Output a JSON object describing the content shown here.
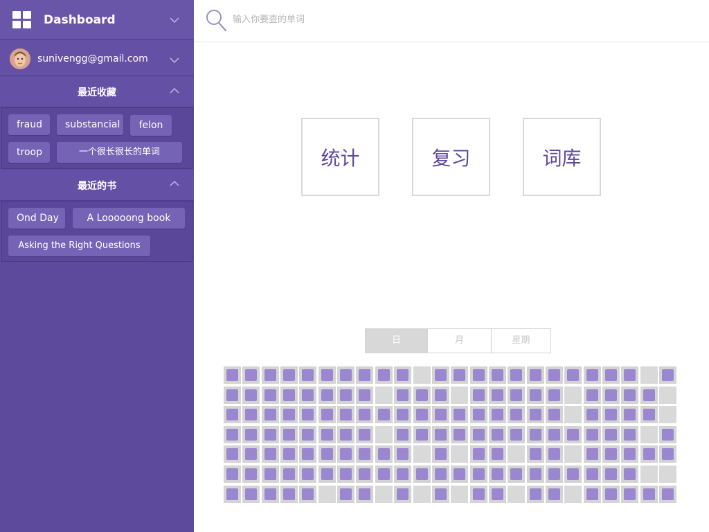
{
  "sidebar": {
    "dashboard_title": "Dashboard",
    "user_email": "sunivengg@gmail.com",
    "recent_favorites": {
      "title": "最近收藏",
      "tags": [
        "fraud",
        "substancial",
        "felon",
        "troop",
        "一个很长很长的单词"
      ]
    },
    "recent_books": {
      "title": "最近的书",
      "tags": [
        "Ond Day",
        "A Looooong book",
        "Asking the Right Questions"
      ]
    }
  },
  "search": {
    "placeholder": "输入你要查的单词"
  },
  "tiles": [
    "统计",
    "复习",
    "词库"
  ],
  "segments": {
    "items": [
      "日",
      "月",
      "星期"
    ],
    "active": "日"
  },
  "colors": {
    "accent": "#5d4a9c",
    "cell_on": "#9b87cf",
    "cell_off": "#d9d9d9"
  },
  "activity_grid": [
    [
      1,
      1,
      1,
      1,
      1,
      1,
      1,
      1,
      1,
      1,
      0,
      1,
      1,
      1,
      1,
      1,
      1,
      1,
      1,
      1,
      1,
      1,
      0,
      1
    ],
    [
      1,
      1,
      1,
      1,
      1,
      1,
      1,
      1,
      0,
      1,
      1,
      1,
      0,
      1,
      1,
      1,
      1,
      1,
      0,
      1,
      1,
      1,
      1,
      0
    ],
    [
      1,
      1,
      1,
      1,
      1,
      1,
      1,
      1,
      1,
      1,
      1,
      1,
      1,
      1,
      1,
      1,
      1,
      1,
      0,
      1,
      1,
      1,
      1,
      0
    ],
    [
      1,
      1,
      1,
      1,
      1,
      1,
      1,
      1,
      0,
      1,
      1,
      1,
      1,
      1,
      1,
      1,
      1,
      1,
      1,
      1,
      1,
      1,
      0,
      1
    ],
    [
      1,
      1,
      1,
      1,
      1,
      1,
      1,
      1,
      1,
      1,
      0,
      1,
      0,
      1,
      1,
      0,
      1,
      1,
      0,
      1,
      1,
      1,
      1,
      1
    ],
    [
      1,
      1,
      1,
      1,
      1,
      1,
      1,
      1,
      1,
      1,
      1,
      1,
      1,
      1,
      1,
      1,
      1,
      1,
      1,
      1,
      1,
      1,
      0,
      0
    ],
    [
      1,
      1,
      1,
      1,
      1,
      0,
      1,
      1,
      0,
      1,
      0,
      1,
      0,
      1,
      1,
      0,
      1,
      1,
      0,
      1,
      1,
      1,
      1,
      1
    ]
  ]
}
